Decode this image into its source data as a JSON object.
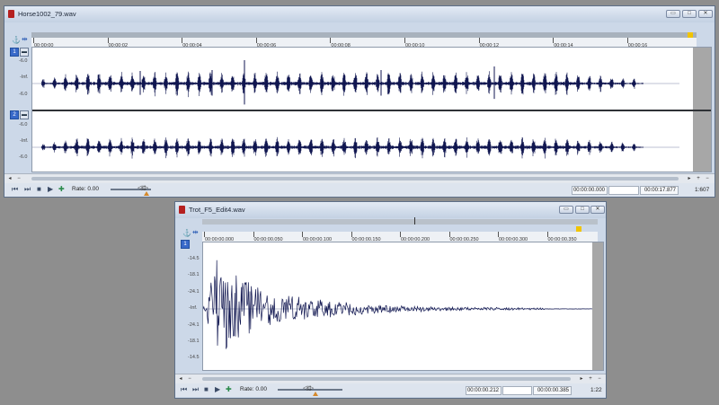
{
  "window_top": {
    "title": "Horse1002_79.wav",
    "timeline_labels": [
      "00:00:00",
      "00:00:02",
      "00:00:04",
      "00:00:06",
      "00:00:08",
      "00:00:10",
      "00:00:12",
      "00:00:14",
      "00:00:16"
    ],
    "channels": [
      {
        "number": "1",
        "db_labels": [
          "-6.0",
          "-Inf.",
          "-6.0"
        ]
      },
      {
        "number": "2",
        "db_labels": [
          "-6.0",
          "-Inf.",
          "-6.0"
        ]
      }
    ],
    "transport": {
      "rate_label": "Rate: 0.00",
      "selection_start": "00:00:00.000",
      "selection_end": "",
      "selection_length": "00:00:17.877",
      "zoom_ratio": "1:607"
    }
  },
  "window_bottom": {
    "title": "Trot_F5_Edit4.wav",
    "timeline_labels": [
      "00:00:00.000",
      "00:00:00.050",
      "00:00:00.100",
      "00:00:00.150",
      "00:00:00.200",
      "00:00:00.250",
      "00:00:00.300",
      "00:00:00.350"
    ],
    "channels": [
      {
        "number": "1",
        "db_labels": [
          "-14.5",
          "-18.1",
          "-24.1",
          "-Inf.",
          "-24.1",
          "-18.1",
          "-14.5"
        ]
      }
    ],
    "transport": {
      "rate_label": "Rate: 0.00",
      "selection_start": "00:00:00.212",
      "selection_end": "",
      "selection_length": "00:00:00.385",
      "zoom_ratio": "1:22"
    }
  },
  "colors": {
    "background": "#8e8e8e",
    "waveform": "#101650",
    "channel_button": "#3869c9",
    "cursor_marker": "#f1c400"
  }
}
